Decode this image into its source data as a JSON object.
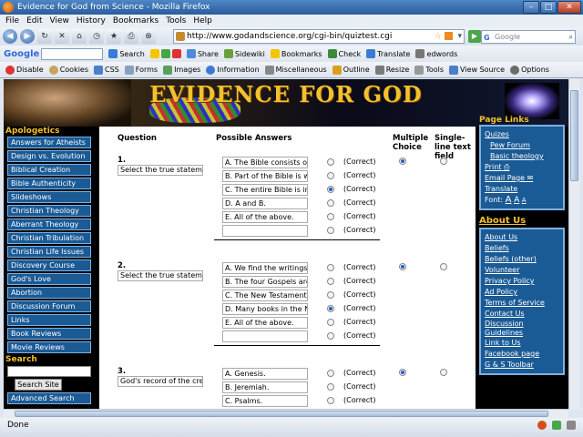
{
  "window": {
    "title": "Evidence for God from Science - Mozilla Firefox"
  },
  "menu": [
    "File",
    "Edit",
    "View",
    "History",
    "Bookmarks",
    "Tools",
    "Help"
  ],
  "nav": {
    "url": "http://www.godandscience.org/cgi-bin/quiztest.cgi",
    "search_placeholder": "Google"
  },
  "google_toolbar": {
    "logo": "Google",
    "search_label": "Search",
    "share_label": "Share",
    "sidewiki_label": "Sidewiki",
    "bookmarks_label": "Bookmarks",
    "check_label": "Check",
    "translate_label": "Translate",
    "user_label": "edwords"
  },
  "dev_toolbar": [
    "Disable",
    "Cookies",
    "CSS",
    "Forms",
    "Images",
    "Information",
    "Miscellaneous",
    "Outline",
    "Resize",
    "Tools",
    "View Source",
    "Options"
  ],
  "page": {
    "banner_title": "EVIDENCE FOR GOD",
    "left": {
      "heading": "Apologetics",
      "links": [
        "Answers for Atheists",
        "Design vs. Evolution",
        "Biblical Creation",
        "Bible Authenticity",
        "Slideshows",
        "Christian Theology",
        "Aberrant Theology",
        "Christian Tribulation",
        "Christian Life Issues",
        "Discovery Course",
        "God's Love",
        "Abortion",
        "Discussion Forum",
        "Links",
        "Book Reviews",
        "Movie Reviews"
      ],
      "search_heading": "Search",
      "search_button": "Search Site",
      "advanced_search": "Advanced Search"
    },
    "main": {
      "col_question": "Question",
      "col_answers": "Possible Answers",
      "col_multiple": "Multiple Choice",
      "col_single": "Single-line text field",
      "correct_label": "(Correct)",
      "questions": [
        {
          "num": "1.",
          "text": "Select the true statemen",
          "answers": [
            "A. The Bible consists of",
            "B. Part of the Bible is wis",
            "C. The entire Bible is ins",
            "D. A and B.",
            "E. All of the above.",
            ""
          ]
        },
        {
          "num": "2.",
          "text": "Select the true statemen",
          "answers": [
            "A. We find the writings of",
            "B. The four Gospels are",
            "C. The New Testament I",
            "D. Many books in the Ne",
            "E. All of the above.",
            ""
          ]
        },
        {
          "num": "3.",
          "text": "God's record of the crea",
          "answers": [
            "A. Genesis.",
            "B. Jeremiah.",
            "C. Psalms."
          ]
        }
      ]
    },
    "right": {
      "page_links_heading": "Page Links",
      "page_links": [
        "Quizes",
        "Pew Forum",
        "Basic theology",
        "Print",
        "Email Page",
        "Translate"
      ],
      "font_label": "Font:",
      "font_sizes": [
        "A",
        "A",
        "A"
      ],
      "about_heading": "About Us",
      "about_links": [
        "About Us",
        "Beliefs",
        "Beliefs (other)",
        "Volunteer",
        "Privacy Policy",
        "Ad Policy",
        "Terms of Service",
        "Contact Us",
        "Discussion Guidelines",
        "Link to Us",
        "Facebook page",
        "G & S Toolbar"
      ]
    }
  },
  "status": {
    "text": "Done"
  }
}
